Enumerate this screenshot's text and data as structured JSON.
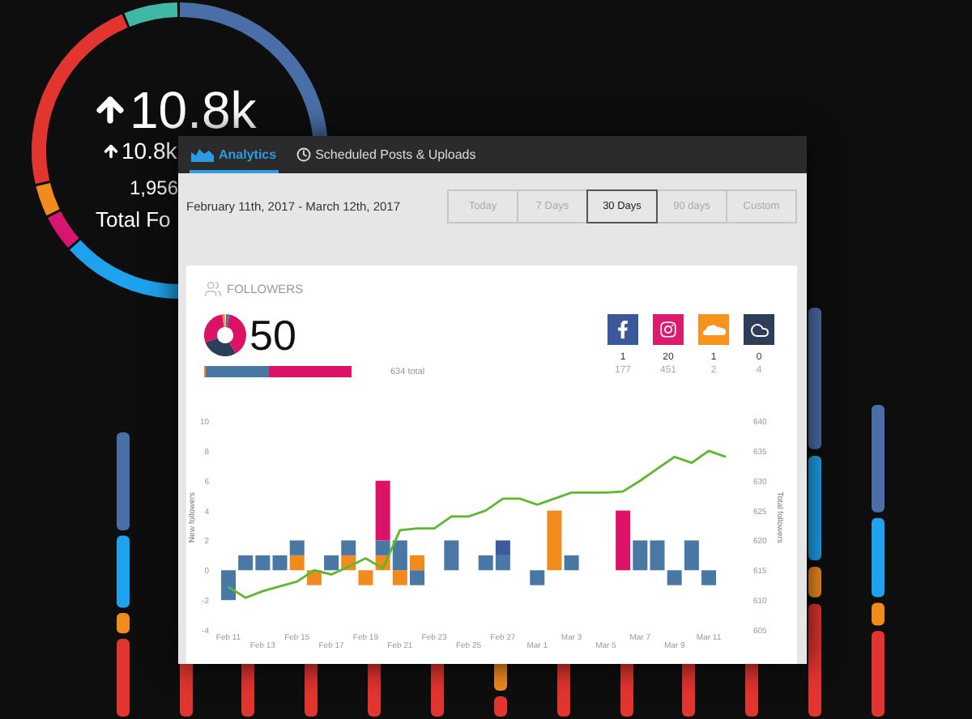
{
  "background": {
    "headline": "10.8k",
    "subheadline": "10.8k",
    "total": "1,956",
    "total_label": "Total Fo"
  },
  "window": {
    "tabs": [
      {
        "label": "Analytics",
        "kind": "chart",
        "selected": true
      },
      {
        "label": "Scheduled Posts & Uploads",
        "kind": "clock",
        "selected": false
      }
    ]
  },
  "date_range": "February 11th, 2017 - March 12th, 2017",
  "ranges": [
    {
      "label": "Today",
      "selected": false
    },
    {
      "label": "7 Days",
      "selected": false
    },
    {
      "label": "30 Days",
      "selected": true
    },
    {
      "label": "90 days",
      "selected": false
    },
    {
      "label": "Custom",
      "selected": false
    }
  ],
  "followers": {
    "title": "FOLLOWERS",
    "count": "50",
    "level": 0.43,
    "total": "634 total",
    "networks": [
      {
        "kind": "facebook",
        "color": "#3b5998",
        "new": "1",
        "total": "177"
      },
      {
        "kind": "instagram",
        "color": "#dc1a6e",
        "new": "20",
        "total": "451"
      },
      {
        "kind": "soundcloud",
        "color": "#f7921e",
        "new": "1",
        "total": "2"
      },
      {
        "kind": "cloud",
        "color": "#2e3d58",
        "new": "0",
        "total": "4"
      }
    ]
  },
  "chart": {
    "chart_data": {
      "type": "bar",
      "stacked": true,
      "ylabel": "New followers",
      "ylim": [
        -4,
        10
      ],
      "yticks": [
        -4,
        -2,
        0,
        2,
        4,
        6,
        8,
        10
      ],
      "categories": [
        "Feb 11",
        null,
        "Feb 13",
        null,
        "Feb 15",
        null,
        "Feb 17",
        null,
        "Feb 19",
        null,
        "Feb 21",
        null,
        "Feb 23",
        null,
        "Feb 25",
        null,
        "Feb 27",
        null,
        "Mar 1",
        null,
        "Mar 3",
        null,
        "Mar 5",
        null,
        "Mar 7",
        null,
        "Mar 9",
        null,
        "Mar 11",
        null
      ],
      "series": [
        {
          "color": "#f28b1e",
          "values": [
            0,
            0,
            0,
            0,
            1,
            -1,
            0,
            1,
            -1,
            1,
            -1,
            1,
            0,
            0,
            0,
            0,
            0,
            0,
            0,
            4,
            0,
            0,
            0,
            0,
            0,
            0,
            0,
            0,
            0,
            0
          ]
        },
        {
          "color": "#4a78a4",
          "values": [
            -2,
            1,
            1,
            1,
            1,
            0,
            1,
            1,
            0,
            1,
            2,
            -1,
            0,
            2,
            0,
            1,
            1,
            0,
            -1,
            0,
            1,
            0,
            0,
            0,
            2,
            2,
            -1,
            2,
            -1,
            0
          ]
        },
        {
          "color": "#3c5a9c",
          "values": [
            0,
            0,
            0,
            0,
            0,
            0,
            0,
            0,
            0,
            0,
            0,
            0,
            0,
            0,
            0,
            0,
            1,
            0,
            0,
            0,
            0,
            0,
            0,
            0,
            0,
            0,
            0,
            0,
            0,
            0
          ]
        },
        {
          "color": "#dc1267",
          "values": [
            0,
            0,
            0,
            0,
            0,
            0,
            0,
            0,
            0,
            4,
            0,
            0,
            0,
            0,
            0,
            0,
            0,
            0,
            0,
            0,
            0,
            0,
            0,
            4,
            0,
            0,
            0,
            0,
            0,
            0
          ]
        }
      ]
    }
  },
  "trend": {
    "chart_data": {
      "type": "line",
      "ylabel": "Total followers",
      "ylim": [
        605,
        640
      ],
      "yticks": [
        605,
        610,
        615,
        620,
        625,
        630,
        635,
        640
      ],
      "series": [
        {
          "color": "#5db82c",
          "values": [
            612.2,
            610.4,
            611.5,
            612.3,
            613.1,
            615,
            614.3,
            615.6,
            617,
            615.3,
            621.7,
            622,
            622,
            624,
            624,
            625,
            627,
            627,
            626,
            627,
            628,
            628,
            628,
            628.2,
            630,
            632,
            634,
            633,
            635,
            634
          ]
        }
      ]
    }
  }
}
